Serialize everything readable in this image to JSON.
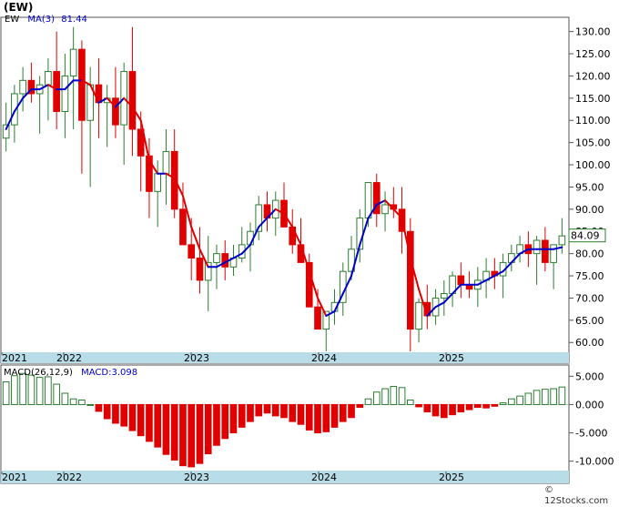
{
  "header": {
    "ticker": "(EW)",
    "footer_credit": "© 12Stocks.com"
  },
  "colors": {
    "up": "#2e7d32",
    "down": "#e00000",
    "ma": "#0000cc",
    "macd": "#0000cc",
    "axis_band": "#b8dce8",
    "price_box": "#2e7d32"
  },
  "chart_data": [
    {
      "type": "candlestick",
      "legend": {
        "series": "EW",
        "ma_label": "MA(3)",
        "ma_value": "81.44"
      },
      "current_price_label": "84.09",
      "ylim": [
        58,
        133
      ],
      "yticks": [
        "130.00",
        "125.00",
        "120.00",
        "115.00",
        "110.00",
        "105.00",
        "100.00",
        "95.00",
        "90.00",
        "85.00",
        "80.00",
        "75.00",
        "70.00",
        "65.00",
        "60.00"
      ],
      "xticks": [
        "2021",
        "2022",
        "2023",
        "2024",
        "2025"
      ],
      "candles": [
        [
          106,
          114,
          103,
          109
        ],
        [
          109,
          118,
          105,
          116
        ],
        [
          116,
          122,
          112,
          119
        ],
        [
          119,
          123,
          114,
          116
        ],
        [
          116,
          120,
          107,
          118
        ],
        [
          118,
          124,
          110,
          121
        ],
        [
          121,
          130,
          108,
          112
        ],
        [
          112,
          125,
          106,
          120
        ],
        [
          120,
          131,
          108,
          126
        ],
        [
          126,
          128,
          98,
          110
        ],
        [
          110,
          122,
          95,
          118
        ],
        [
          118,
          124,
          106,
          114
        ],
        [
          114,
          118,
          104,
          115
        ],
        [
          115,
          122,
          106,
          109
        ],
        [
          109,
          123,
          100,
          121
        ],
        [
          121,
          131,
          102,
          108
        ],
        [
          108,
          112,
          94,
          102
        ],
        [
          102,
          106,
          88,
          94
        ],
        [
          94,
          101,
          86,
          98
        ],
        [
          98,
          108,
          91,
          103
        ],
        [
          103,
          108,
          88,
          90
        ],
        [
          90,
          96,
          83,
          82
        ],
        [
          82,
          88,
          74,
          79
        ],
        [
          79,
          86,
          71,
          74
        ],
        [
          74,
          84,
          67,
          78
        ],
        [
          78,
          82,
          72,
          80
        ],
        [
          80,
          83,
          74,
          77
        ],
        [
          77,
          82,
          75,
          79
        ],
        [
          79,
          86,
          78,
          82
        ],
        [
          82,
          87,
          76,
          85
        ],
        [
          85,
          93,
          83,
          91
        ],
        [
          91,
          94,
          85,
          88
        ],
        [
          88,
          94,
          84,
          92
        ],
        [
          92,
          96,
          87,
          86
        ],
        [
          86,
          90,
          80,
          82
        ],
        [
          82,
          88,
          78,
          78
        ],
        [
          78,
          80,
          70,
          68
        ],
        [
          68,
          72,
          64,
          63
        ],
        [
          63,
          67,
          58,
          67
        ],
        [
          67,
          72,
          64,
          69
        ],
        [
          69,
          78,
          66,
          76
        ],
        [
          76,
          84,
          74,
          81
        ],
        [
          81,
          90,
          78,
          88
        ],
        [
          88,
          96,
          86,
          96
        ],
        [
          96,
          98,
          86,
          89
        ],
        [
          89,
          94,
          85,
          91
        ],
        [
          91,
          95,
          88,
          90
        ],
        [
          90,
          95,
          80,
          85
        ],
        [
          85,
          88,
          58,
          63
        ],
        [
          63,
          70,
          60,
          69
        ],
        [
          69,
          73,
          63,
          66
        ],
        [
          66,
          72,
          64,
          70
        ],
        [
          70,
          74,
          66,
          71
        ],
        [
          71,
          76,
          68,
          75
        ],
        [
          75,
          78,
          70,
          73
        ],
        [
          73,
          76,
          70,
          72
        ],
        [
          72,
          77,
          68,
          74
        ],
        [
          74,
          79,
          70,
          76
        ],
        [
          76,
          79,
          72,
          75
        ],
        [
          75,
          80,
          70,
          78
        ],
        [
          78,
          82,
          76,
          80
        ],
        [
          80,
          84,
          78,
          82
        ],
        [
          82,
          85,
          77,
          80
        ],
        [
          80,
          84,
          73,
          83
        ],
        [
          83,
          86,
          76,
          78
        ],
        [
          78,
          82,
          72,
          82
        ],
        [
          82,
          88,
          80,
          84
        ]
      ],
      "ma": [
        108,
        112,
        115,
        117,
        117,
        118,
        117,
        117,
        119,
        119,
        118,
        114,
        115,
        113,
        115,
        113,
        110,
        101,
        98,
        98,
        97,
        93,
        86,
        81,
        77,
        77,
        78,
        79,
        80,
        82,
        86,
        88,
        90,
        89,
        86,
        82,
        76,
        70,
        66,
        67,
        71,
        75,
        82,
        88,
        91,
        92,
        90,
        88,
        79,
        72,
        66,
        68,
        69,
        71,
        73,
        73,
        73,
        74,
        75,
        76,
        78,
        80,
        81,
        81,
        81,
        81,
        81.44
      ]
    },
    {
      "type": "bar",
      "legend": {
        "label": "MACD(26,12,9)",
        "value_label": "MACD:3.098"
      },
      "ylim": [
        -11.5,
        6.5
      ],
      "yticks": [
        "5.000",
        "0.000",
        "-5.000",
        "-10.000"
      ],
      "xticks": [
        "2021",
        "2022",
        "2023",
        "2024",
        "2025"
      ],
      "values": [
        4.0,
        5.1,
        5.5,
        5.2,
        4.8,
        4.9,
        3.6,
        2.0,
        1.0,
        0.8,
        0.0,
        -1.2,
        -2.5,
        -3.3,
        -3.8,
        -4.6,
        -5.5,
        -6.5,
        -7.5,
        -8.8,
        -9.8,
        -10.8,
        -11.0,
        -10.4,
        -8.7,
        -7.2,
        -6.0,
        -5.0,
        -4.0,
        -3.0,
        -2.0,
        -1.5,
        -2.0,
        -2.3,
        -3.0,
        -3.5,
        -4.5,
        -5.0,
        -4.8,
        -4.0,
        -3.0,
        -2.3,
        -0.5,
        1.0,
        2.2,
        2.8,
        3.2,
        3.0,
        0.8,
        -0.4,
        -1.3,
        -2.0,
        -2.3,
        -1.8,
        -1.3,
        -0.9,
        -0.5,
        -0.6,
        -0.3,
        0.3,
        1.0,
        1.5,
        2.0,
        2.5,
        2.7,
        2.8,
        3.098
      ]
    }
  ]
}
